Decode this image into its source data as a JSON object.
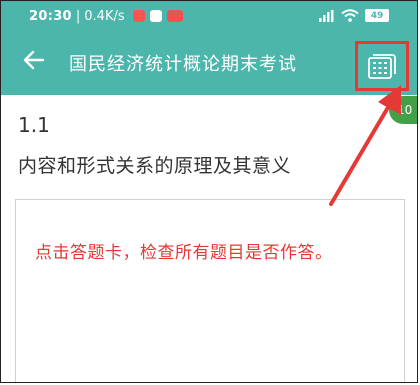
{
  "statusbar": {
    "time": "20:30",
    "speed": "0.4K/s",
    "battery": "49"
  },
  "appbar": {
    "title": "国民经济统计概论期末考试"
  },
  "badge": "10",
  "question": {
    "number": "1.1",
    "text": "内容和形式关系的原理及其意义"
  },
  "hint": "点击答题卡，检查所有题目是否作答。",
  "colors": {
    "header": "#4db6ac",
    "highlight": "#e53935",
    "badge": "#43a047"
  },
  "icons": [
    "back-arrow-icon",
    "answer-card-icon",
    "wifi-icon",
    "signal-icon",
    "battery-icon"
  ]
}
